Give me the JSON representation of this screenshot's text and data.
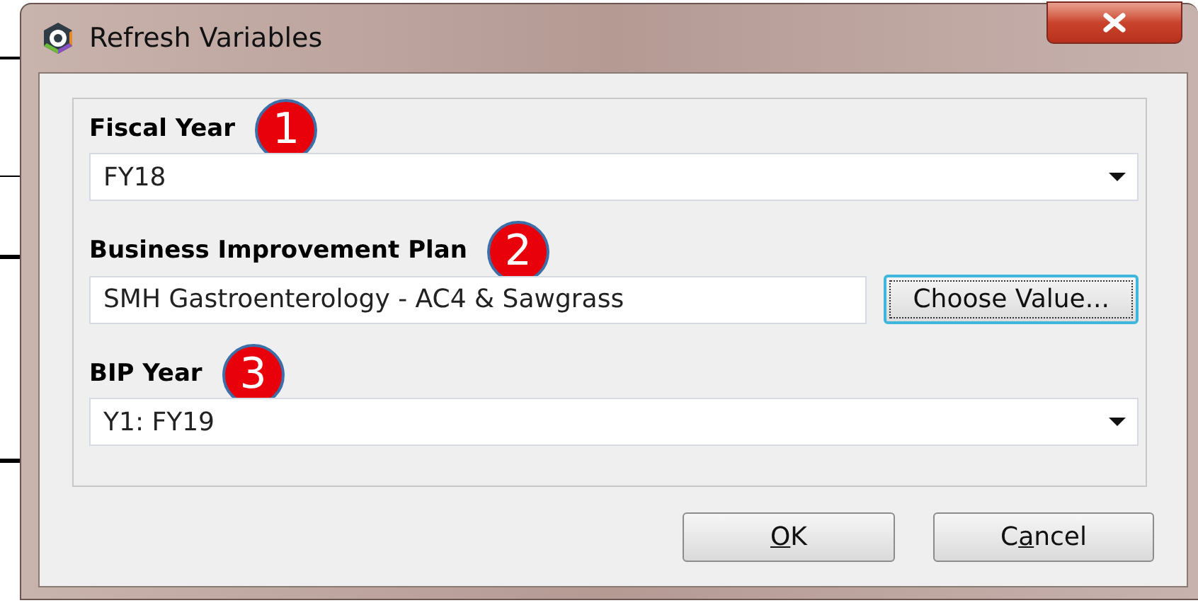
{
  "window": {
    "title": "Refresh Variables"
  },
  "fields": [
    {
      "kind": "dropdown",
      "label": "Fiscal Year",
      "callout": "1",
      "value": "FY18"
    },
    {
      "kind": "text_with_button",
      "label": "Business Improvement Plan",
      "callout": "2",
      "value": "SMH Gastroenterology - AC4 & Sawgrass",
      "button": "Choose Value..."
    },
    {
      "kind": "dropdown",
      "label": "BIP Year",
      "callout": "3",
      "value": "Y1: FY19"
    }
  ],
  "buttons": [
    {
      "label_parts": [
        {
          "text": "O",
          "underlined": true
        },
        {
          "text": "K",
          "underlined": false
        }
      ]
    },
    {
      "label_parts": [
        {
          "text": "C",
          "underlined": false
        },
        {
          "text": "a",
          "underlined": true
        },
        {
          "text": "ncel",
          "underlined": false
        }
      ]
    }
  ]
}
